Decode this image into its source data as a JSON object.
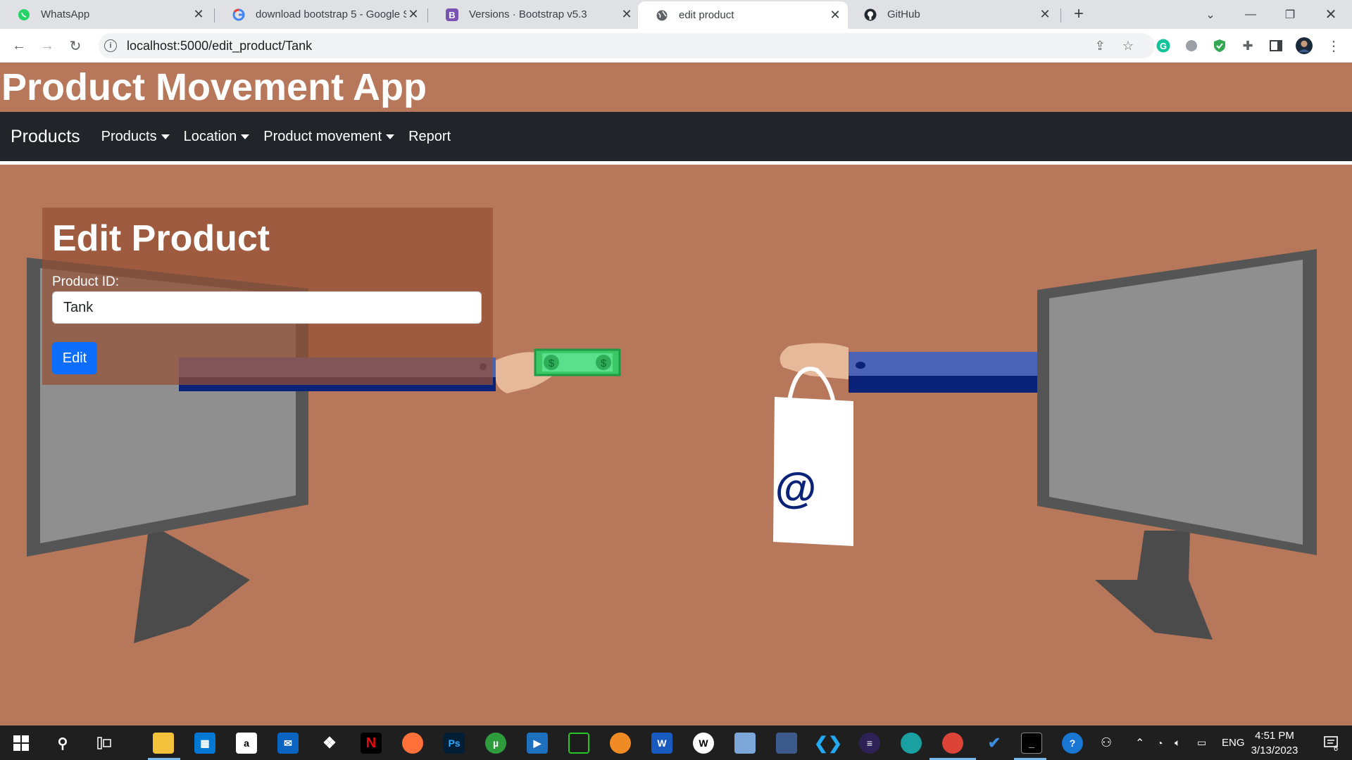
{
  "browser": {
    "tabs": [
      {
        "title": "WhatsApp",
        "icon": "whatsapp-icon"
      },
      {
        "title": "download bootstrap 5 - Google S",
        "icon": "google-icon"
      },
      {
        "title": "Versions · Bootstrap v5.3",
        "icon": "bootstrap-icon"
      },
      {
        "title": "edit product",
        "icon": "globe-icon",
        "active": true
      },
      {
        "title": "GitHub",
        "icon": "github-icon"
      }
    ],
    "url": "localhost:5000/edit_product/Tank"
  },
  "app": {
    "title": "Product Movement App",
    "navbar": {
      "brand": "Products",
      "items": [
        "Products",
        "Location",
        "Product movement",
        "Report"
      ]
    }
  },
  "form": {
    "heading": "Edit Product",
    "product_id_label": "Product ID:",
    "product_id_value": "Tank",
    "submit_label": "Edit"
  },
  "taskbar": {
    "language": "ENG",
    "time": "4:51 PM",
    "date": "3/13/2023",
    "notification_count": "6"
  },
  "colors": {
    "page_background": "#b7775a",
    "navbar": "#212529",
    "primary_button": "#0d6efd"
  }
}
